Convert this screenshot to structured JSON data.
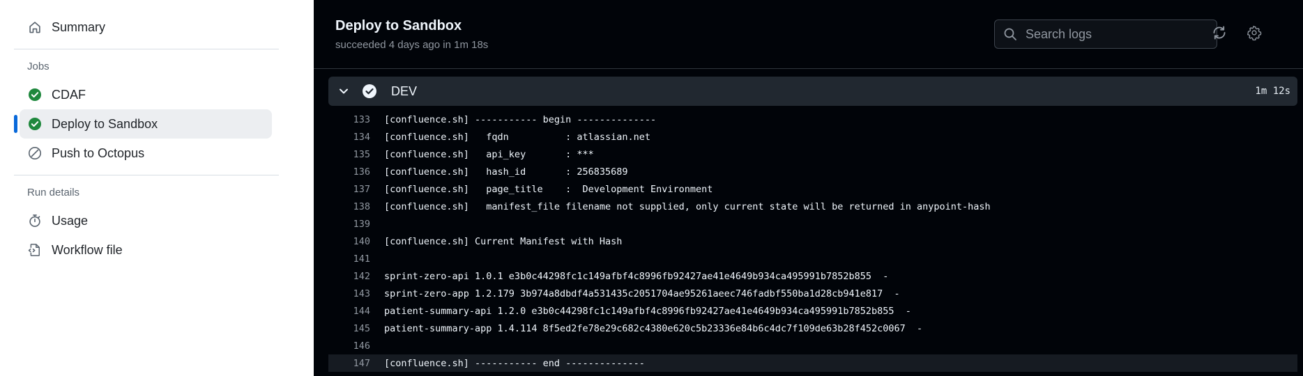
{
  "sidebar": {
    "summary": {
      "label": "Summary",
      "icon": "home-icon"
    },
    "jobs_title": "Jobs",
    "jobs": [
      {
        "label": "CDAF",
        "icon": "check-circle-icon",
        "status": "success"
      },
      {
        "label": "Deploy to Sandbox",
        "icon": "check-circle-icon",
        "status": "success",
        "active": true
      },
      {
        "label": "Push to Octopus",
        "icon": "skipped-icon",
        "status": "skipped"
      }
    ],
    "run_details_title": "Run details",
    "run_details": [
      {
        "label": "Usage",
        "icon": "stopwatch-icon"
      },
      {
        "label": "Workflow file",
        "icon": "file-code-icon"
      }
    ]
  },
  "header": {
    "title": "Deploy to Sandbox",
    "subtitle": "succeeded 4 days ago in 1m 18s",
    "search_placeholder": "Search logs",
    "refresh_icon": "sync-icon",
    "settings_icon": "gear-icon"
  },
  "step": {
    "name": "DEV",
    "duration": "1m 12s",
    "status": "success"
  },
  "log": [
    {
      "num": "133",
      "text": "[confluence.sh] ----------- begin --------------"
    },
    {
      "num": "134",
      "text": "[confluence.sh]   fqdn          : atlassian.net"
    },
    {
      "num": "135",
      "text": "[confluence.sh]   api_key       : ***"
    },
    {
      "num": "136",
      "text": "[confluence.sh]   hash_id       : 256835689"
    },
    {
      "num": "137",
      "text": "[confluence.sh]   page_title    :  Development Environment"
    },
    {
      "num": "138",
      "text": "[confluence.sh]   manifest_file filename not supplied, only current state will be returned in anypoint-hash"
    },
    {
      "num": "139",
      "text": ""
    },
    {
      "num": "140",
      "text": "[confluence.sh] Current Manifest with Hash"
    },
    {
      "num": "141",
      "text": ""
    },
    {
      "num": "142",
      "text": "sprint-zero-api 1.0.1 e3b0c44298fc1c149afbf4c8996fb92427ae41e4649b934ca495991b7852b855  -"
    },
    {
      "num": "143",
      "text": "sprint-zero-app 1.2.179 3b974a8dbdf4a531435c2051704ae95261aeec746fadbf550ba1d28cb941e817  -"
    },
    {
      "num": "144",
      "text": "patient-summary-api 1.2.0 e3b0c44298fc1c149afbf4c8996fb92427ae41e4649b934ca495991b7852b855  -"
    },
    {
      "num": "145",
      "text": "patient-summary-app 1.4.114 8f5ed2fe78e29c682c4380e620c5b23336e84b6c4dc7f109de63b28f452c0067  -"
    },
    {
      "num": "146",
      "text": ""
    },
    {
      "num": "147",
      "text": "[confluence.sh] ----------- end --------------",
      "highlight": true
    }
  ],
  "colors": {
    "success": "#1f883d",
    "accent": "#0969da",
    "skipped": "#59636e"
  }
}
